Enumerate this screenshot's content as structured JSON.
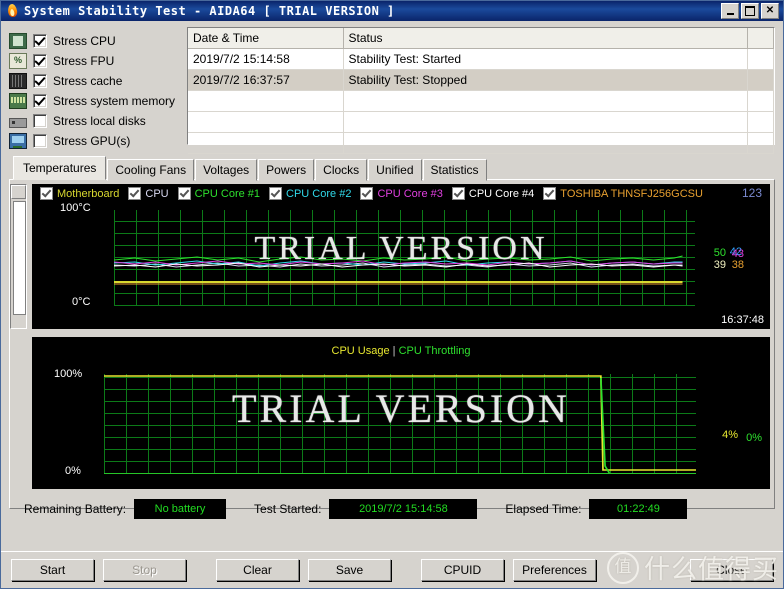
{
  "window": {
    "title": "System Stability Test - AIDA64   [ TRIAL VERSION ]",
    "icon": "flame-icon",
    "minimize": "_",
    "maximize": "□",
    "close": "✕"
  },
  "options": [
    {
      "label": "Stress CPU",
      "checked": true,
      "icon": "cpu-chip-icon"
    },
    {
      "label": "Stress FPU",
      "checked": true,
      "icon": "fpu-percent-icon"
    },
    {
      "label": "Stress cache",
      "checked": true,
      "icon": "cache-icon"
    },
    {
      "label": "Stress system memory",
      "checked": true,
      "icon": "memory-module-icon"
    },
    {
      "label": "Stress local disks",
      "checked": false,
      "icon": "hard-disk-icon"
    },
    {
      "label": "Stress GPU(s)",
      "checked": false,
      "icon": "gpu-monitor-icon"
    }
  ],
  "log": {
    "columns": [
      "Date & Time",
      "Status",
      ""
    ],
    "rows": [
      {
        "datetime": "2019/7/2 15:14:58",
        "status": "Stability Test: Started"
      },
      {
        "datetime": "2019/7/2 16:37:57",
        "status": "Stability Test: Stopped"
      },
      {
        "datetime": "",
        "status": ""
      },
      {
        "datetime": "",
        "status": ""
      },
      {
        "datetime": "",
        "status": ""
      }
    ]
  },
  "tabs": [
    {
      "label": "Temperatures",
      "active": true
    },
    {
      "label": "Cooling Fans",
      "active": false
    },
    {
      "label": "Voltages",
      "active": false
    },
    {
      "label": "Powers",
      "active": false
    },
    {
      "label": "Clocks",
      "active": false
    },
    {
      "label": "Unified",
      "active": false
    },
    {
      "label": "Statistics",
      "active": false
    }
  ],
  "temperature_chart": {
    "legend": [
      {
        "label": "Motherboard",
        "color": "#d8d830"
      },
      {
        "label": "CPU",
        "color": "#d8d8f0"
      },
      {
        "label": "CPU Core #1",
        "color": "#2ee02e"
      },
      {
        "label": "CPU Core #2",
        "color": "#30d8e8"
      },
      {
        "label": "CPU Core #3",
        "color": "#e040e0"
      },
      {
        "label": "CPU Core #4",
        "color": "#ffffff"
      },
      {
        "label": "TOSHIBA THNSFJ256GCSU",
        "color": "#e8a030"
      }
    ],
    "y_top": "100°C",
    "y_bottom": "0°C",
    "timestamp": "16:37:48",
    "overlay_number": "123",
    "watermark": "TRIAL VERSION",
    "current_values": [
      {
        "value": "50",
        "color": "#2ee02e"
      },
      {
        "value": "42",
        "color": "#30a0ff"
      },
      {
        "value": "43",
        "color": "#e040e0"
      },
      {
        "value": "39",
        "color": "#f0f0c0"
      },
      {
        "value": "38",
        "color": "#e8a030"
      }
    ]
  },
  "usage_chart": {
    "title_usage": "CPU Usage",
    "title_separator": "|",
    "title_throttling": "CPU Throttling",
    "usage_color": "#e8e830",
    "throttling_color": "#2ee02e",
    "y_top": "100%",
    "y_bottom": "0%",
    "watermark": "TRIAL VERSION",
    "current_usage": "4%",
    "current_throttling": "0%"
  },
  "status": {
    "battery_label": "Remaining Battery:",
    "battery_value": "No battery",
    "started_label": "Test Started:",
    "started_value": "2019/7/2 15:14:58",
    "elapsed_label": "Elapsed Time:",
    "elapsed_value": "01:22:49",
    "value_color": "#22dd22"
  },
  "buttons": [
    {
      "label": "Start",
      "disabled": false
    },
    {
      "label": "Stop",
      "disabled": true
    },
    {
      "label": "Clear",
      "disabled": false
    },
    {
      "label": "Save",
      "disabled": false
    },
    {
      "label": "CPUID",
      "disabled": false
    },
    {
      "label": "Preferences",
      "disabled": false
    },
    {
      "label": "Close",
      "disabled": false
    }
  ],
  "watermark": {
    "logo": "值",
    "text": "什么值得买"
  }
}
